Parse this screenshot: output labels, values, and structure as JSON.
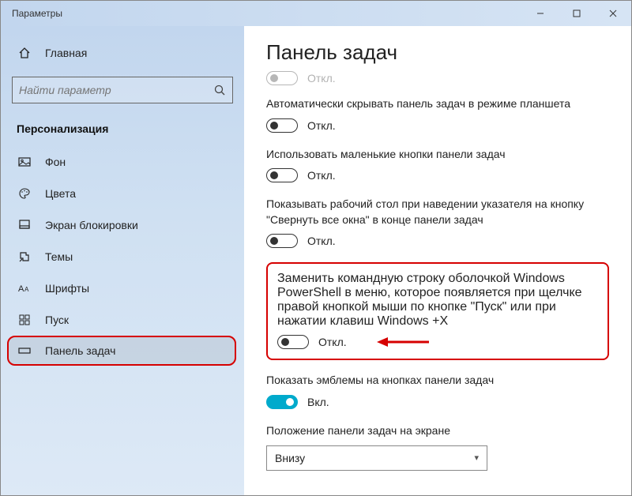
{
  "window": {
    "title": "Параметры"
  },
  "sidebar": {
    "home": "Главная",
    "search_placeholder": "Найти параметр",
    "section": "Персонализация",
    "items": [
      {
        "label": "Фон"
      },
      {
        "label": "Цвета"
      },
      {
        "label": "Экран блокировки"
      },
      {
        "label": "Темы"
      },
      {
        "label": "Шрифты"
      },
      {
        "label": "Пуск"
      },
      {
        "label": "Панель задач"
      }
    ]
  },
  "content": {
    "heading": "Панель задач",
    "cutoff_state": "Откл.",
    "settings": [
      {
        "label": "Автоматически скрывать панель задач в режиме планшета",
        "state": "Откл.",
        "on": false
      },
      {
        "label": "Использовать маленькие кнопки панели задач",
        "state": "Откл.",
        "on": false
      },
      {
        "label": "Показывать рабочий стол при наведении указателя на кнопку \"Свернуть все окна\" в конце панели задач",
        "state": "Откл.",
        "on": false
      },
      {
        "label": "Заменить командную строку оболочкой Windows PowerShell в меню, которое появляется при щелчке правой кнопкой мыши по кнопке \"Пуск\" или при нажатии клавиш Windows +X",
        "state": "Откл.",
        "on": false
      },
      {
        "label": "Показать эмблемы на кнопках панели задач",
        "state": "Вкл.",
        "on": true
      }
    ],
    "position_label": "Положение панели задач на экране",
    "position_value": "Внизу"
  }
}
